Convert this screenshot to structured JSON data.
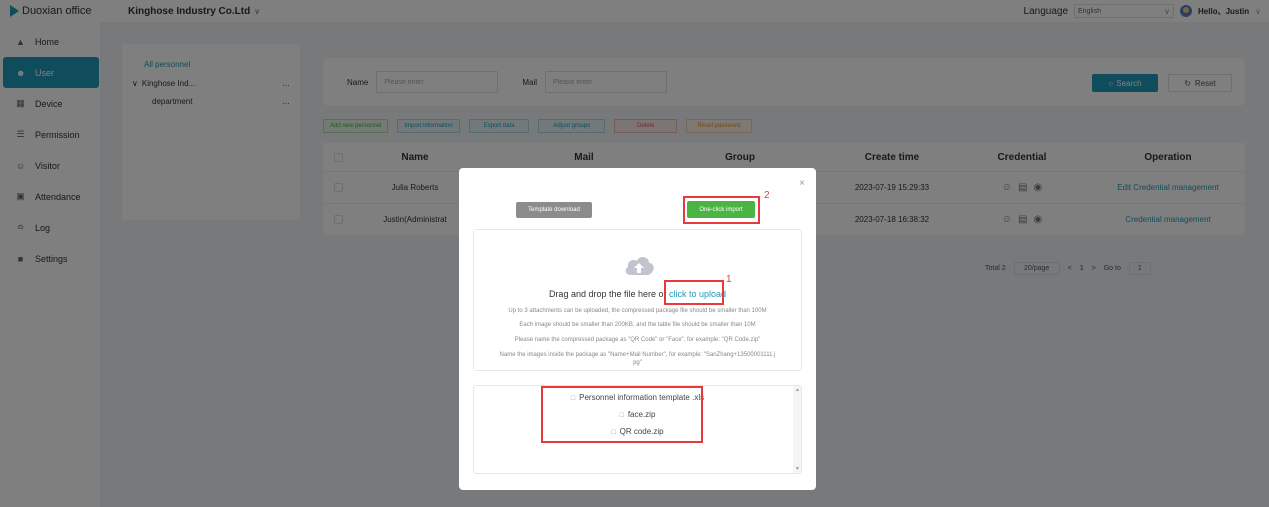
{
  "app": {
    "name": "Duoxian office",
    "company": "Kinghose Industry Co.Ltd",
    "language_label": "Language",
    "language_value": "English",
    "greeting": "Hello、Justin"
  },
  "sidebar": {
    "items": [
      {
        "label": "Home",
        "icon": "home-icon"
      },
      {
        "label": "User",
        "icon": "user-icon",
        "active": true
      },
      {
        "label": "Device",
        "icon": "device-icon"
      },
      {
        "label": "Permission",
        "icon": "permission-icon"
      },
      {
        "label": "Visitor",
        "icon": "visitor-icon"
      },
      {
        "label": "Attendance",
        "icon": "calendar-icon"
      },
      {
        "label": "Log",
        "icon": "log-icon"
      },
      {
        "label": "Settings",
        "icon": "settings-icon"
      }
    ]
  },
  "tree": {
    "all": "All personnel",
    "nodes": [
      {
        "label": "Kinghose Ind...",
        "more": "…"
      },
      {
        "label": "department",
        "more": "…"
      }
    ]
  },
  "filter": {
    "name_label": "Name",
    "name_placeholder": "Please enter",
    "mail_label": "Mail",
    "mail_placeholder": "Please enter",
    "search_label": "Search",
    "reset_label": "Reset"
  },
  "actions": {
    "add": "Add new personnel",
    "import": "Import information",
    "export": "Export data",
    "adjust": "Adjust groups",
    "delete": "Delete",
    "reset_password": "Reset password"
  },
  "table": {
    "headers": {
      "name": "Name",
      "mail": "Mail",
      "group": "Group",
      "create_time": "Create time",
      "credential": "Credential",
      "operation": "Operation"
    },
    "rows": [
      {
        "name": "Julia Roberts",
        "create_time": "2023-07-19 15:29:33",
        "operation": "Edit  Credential management"
      },
      {
        "name": "Justin(Administrat",
        "create_time": "2023-07-18 16:38:32",
        "operation": "Credential management"
      }
    ]
  },
  "pager": {
    "total": "Total 2",
    "page_size": "20/page",
    "current": "1",
    "goto_label": "Go to",
    "goto_value": "1"
  },
  "modal": {
    "template_download": "Template download",
    "one_click_import": "One-click import",
    "drag_text": "Drag and drop the file here or ",
    "click_upload": "click to upload",
    "hints": [
      "Up to 3 attachments can be uploaded, the compressed package file should be smaller than 100M",
      "Each image should be smaller than 200KB, and the table file should be smaller than 10M",
      "Please name the compressed package as \"QR Code\" or \"Face\", for example: \"QR Code.zip\"",
      "Name the images inside the package as \"Name+Mail Number\", for example: \"SanZhang+13500001111.j",
      "pg\""
    ],
    "files": [
      "Personnel information template .xls",
      "face.zip",
      "QR code.zip"
    ],
    "annotations": [
      "1",
      "2"
    ],
    "annotation_color": "#e53b3b"
  },
  "colors": {
    "accent": "#1e9bb8",
    "import_green": "#4bb543"
  }
}
